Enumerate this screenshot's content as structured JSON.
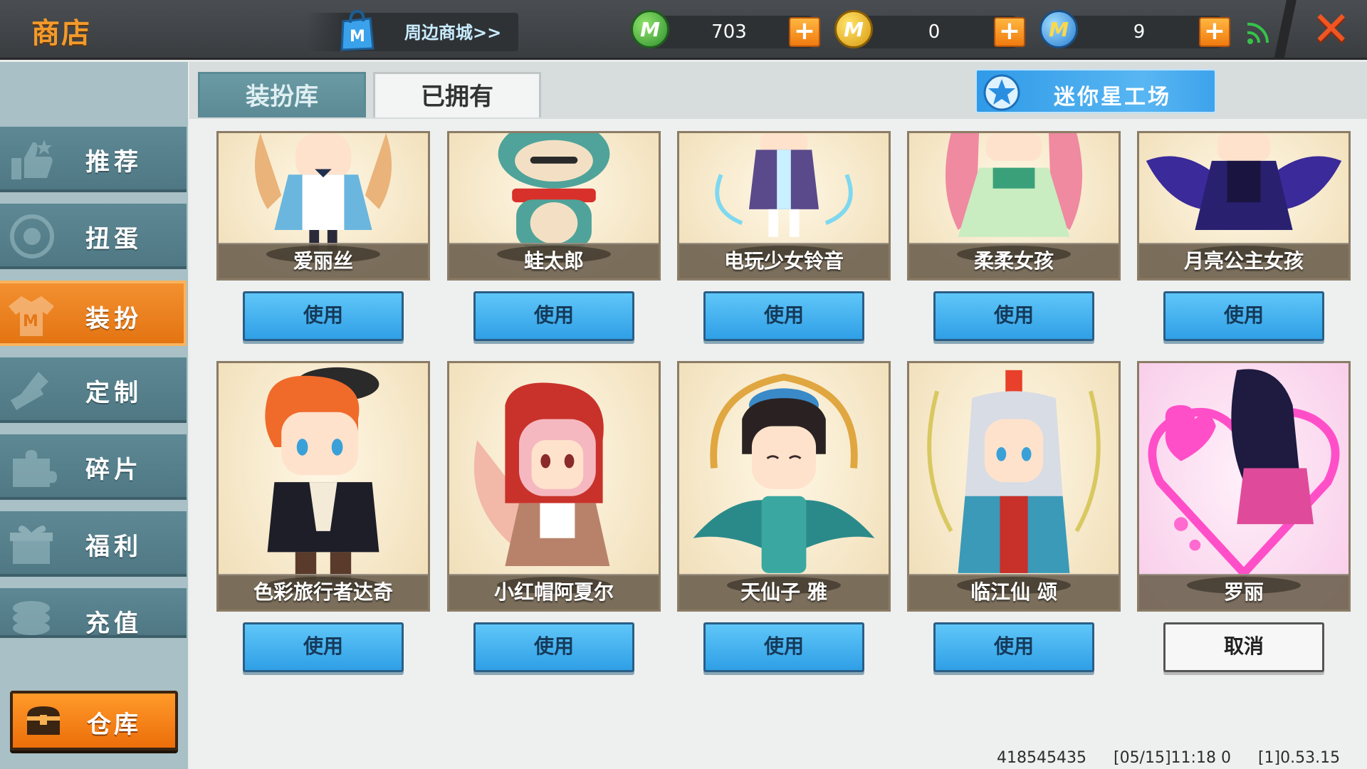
{
  "header": {
    "title": "商店",
    "mall_link": "周边商城>>",
    "currencies": [
      {
        "name": "mini-bean",
        "icon": "green-m-coin-icon",
        "value": "703",
        "color": "#3cab3c"
      },
      {
        "name": "mini-coin",
        "icon": "gold-m-coin-icon",
        "value": "0",
        "color": "#f2c21a"
      },
      {
        "name": "mini-point",
        "icon": "blue-m-coin-icon",
        "value": "9",
        "color": "#3a9be8"
      }
    ],
    "plus_symbol": "+",
    "close_symbol": "✕"
  },
  "sidebar": {
    "items": [
      {
        "label": "推荐",
        "icon": "thumbs-up-icon",
        "active": false
      },
      {
        "label": "扭蛋",
        "icon": "gacha-capsule-icon",
        "active": false
      },
      {
        "label": "装扮",
        "icon": "shirt-icon",
        "active": true
      },
      {
        "label": "定制",
        "icon": "pencil-ruler-icon",
        "active": false
      },
      {
        "label": "碎片",
        "icon": "puzzle-piece-icon",
        "active": false
      },
      {
        "label": "福利",
        "icon": "gift-box-icon",
        "active": false
      },
      {
        "label": "充值",
        "icon": "coin-stack-icon",
        "active": false
      }
    ],
    "warehouse_label": "仓库"
  },
  "tabs": {
    "library": "装扮库",
    "owned": "已拥有",
    "workshop": "迷你星工场"
  },
  "skins": [
    {
      "name": "爱丽丝",
      "button": "使用",
      "theme": "#e9b37a"
    },
    {
      "name": "蛙太郎",
      "button": "使用",
      "theme": "#4fa39a"
    },
    {
      "name": "电玩少女铃音",
      "button": "使用",
      "theme": "#5a4a8c"
    },
    {
      "name": "柔柔女孩",
      "button": "使用",
      "theme": "#ef8aa0"
    },
    {
      "name": "月亮公主女孩",
      "button": "使用",
      "theme": "#3a2a86"
    },
    {
      "name": "色彩旅行者达奇",
      "button": "使用",
      "theme": "#f06a2a"
    },
    {
      "name": "小红帽阿夏尔",
      "button": "使用",
      "theme": "#c8322a"
    },
    {
      "name": "天仙子 雅",
      "button": "使用",
      "theme": "#2a8a8a"
    },
    {
      "name": "临江仙 颂",
      "button": "使用",
      "theme": "#3a9ab8"
    },
    {
      "name": "罗丽",
      "button": "取消",
      "theme": "#ff4fc8"
    }
  ],
  "footer": {
    "uid": "418545435",
    "time": "[05/15]11:18 0",
    "version": "[1]0.53.15"
  }
}
